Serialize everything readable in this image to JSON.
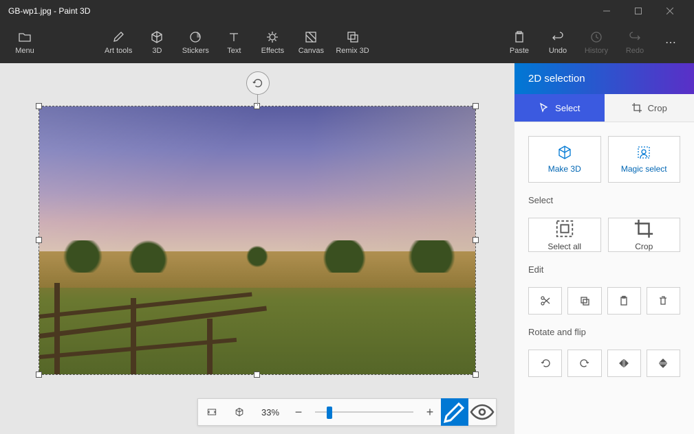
{
  "titlebar": {
    "filename": "GB-wp1.jpg",
    "appname": "Paint 3D"
  },
  "toolbar": {
    "menu": "Menu",
    "art_tools": "Art tools",
    "threed": "3D",
    "stickers": "Stickers",
    "text": "Text",
    "effects": "Effects",
    "canvas": "Canvas",
    "remix3d": "Remix 3D",
    "paste": "Paste",
    "undo": "Undo",
    "history": "History",
    "redo": "Redo"
  },
  "zoom": {
    "value": "33%"
  },
  "panel": {
    "title": "2D selection",
    "mode_select": "Select",
    "mode_crop": "Crop",
    "make3d": "Make 3D",
    "magic_select": "Magic select",
    "section_select": "Select",
    "select_all": "Select all",
    "crop": "Crop",
    "section_edit": "Edit",
    "section_rotate": "Rotate and flip"
  }
}
